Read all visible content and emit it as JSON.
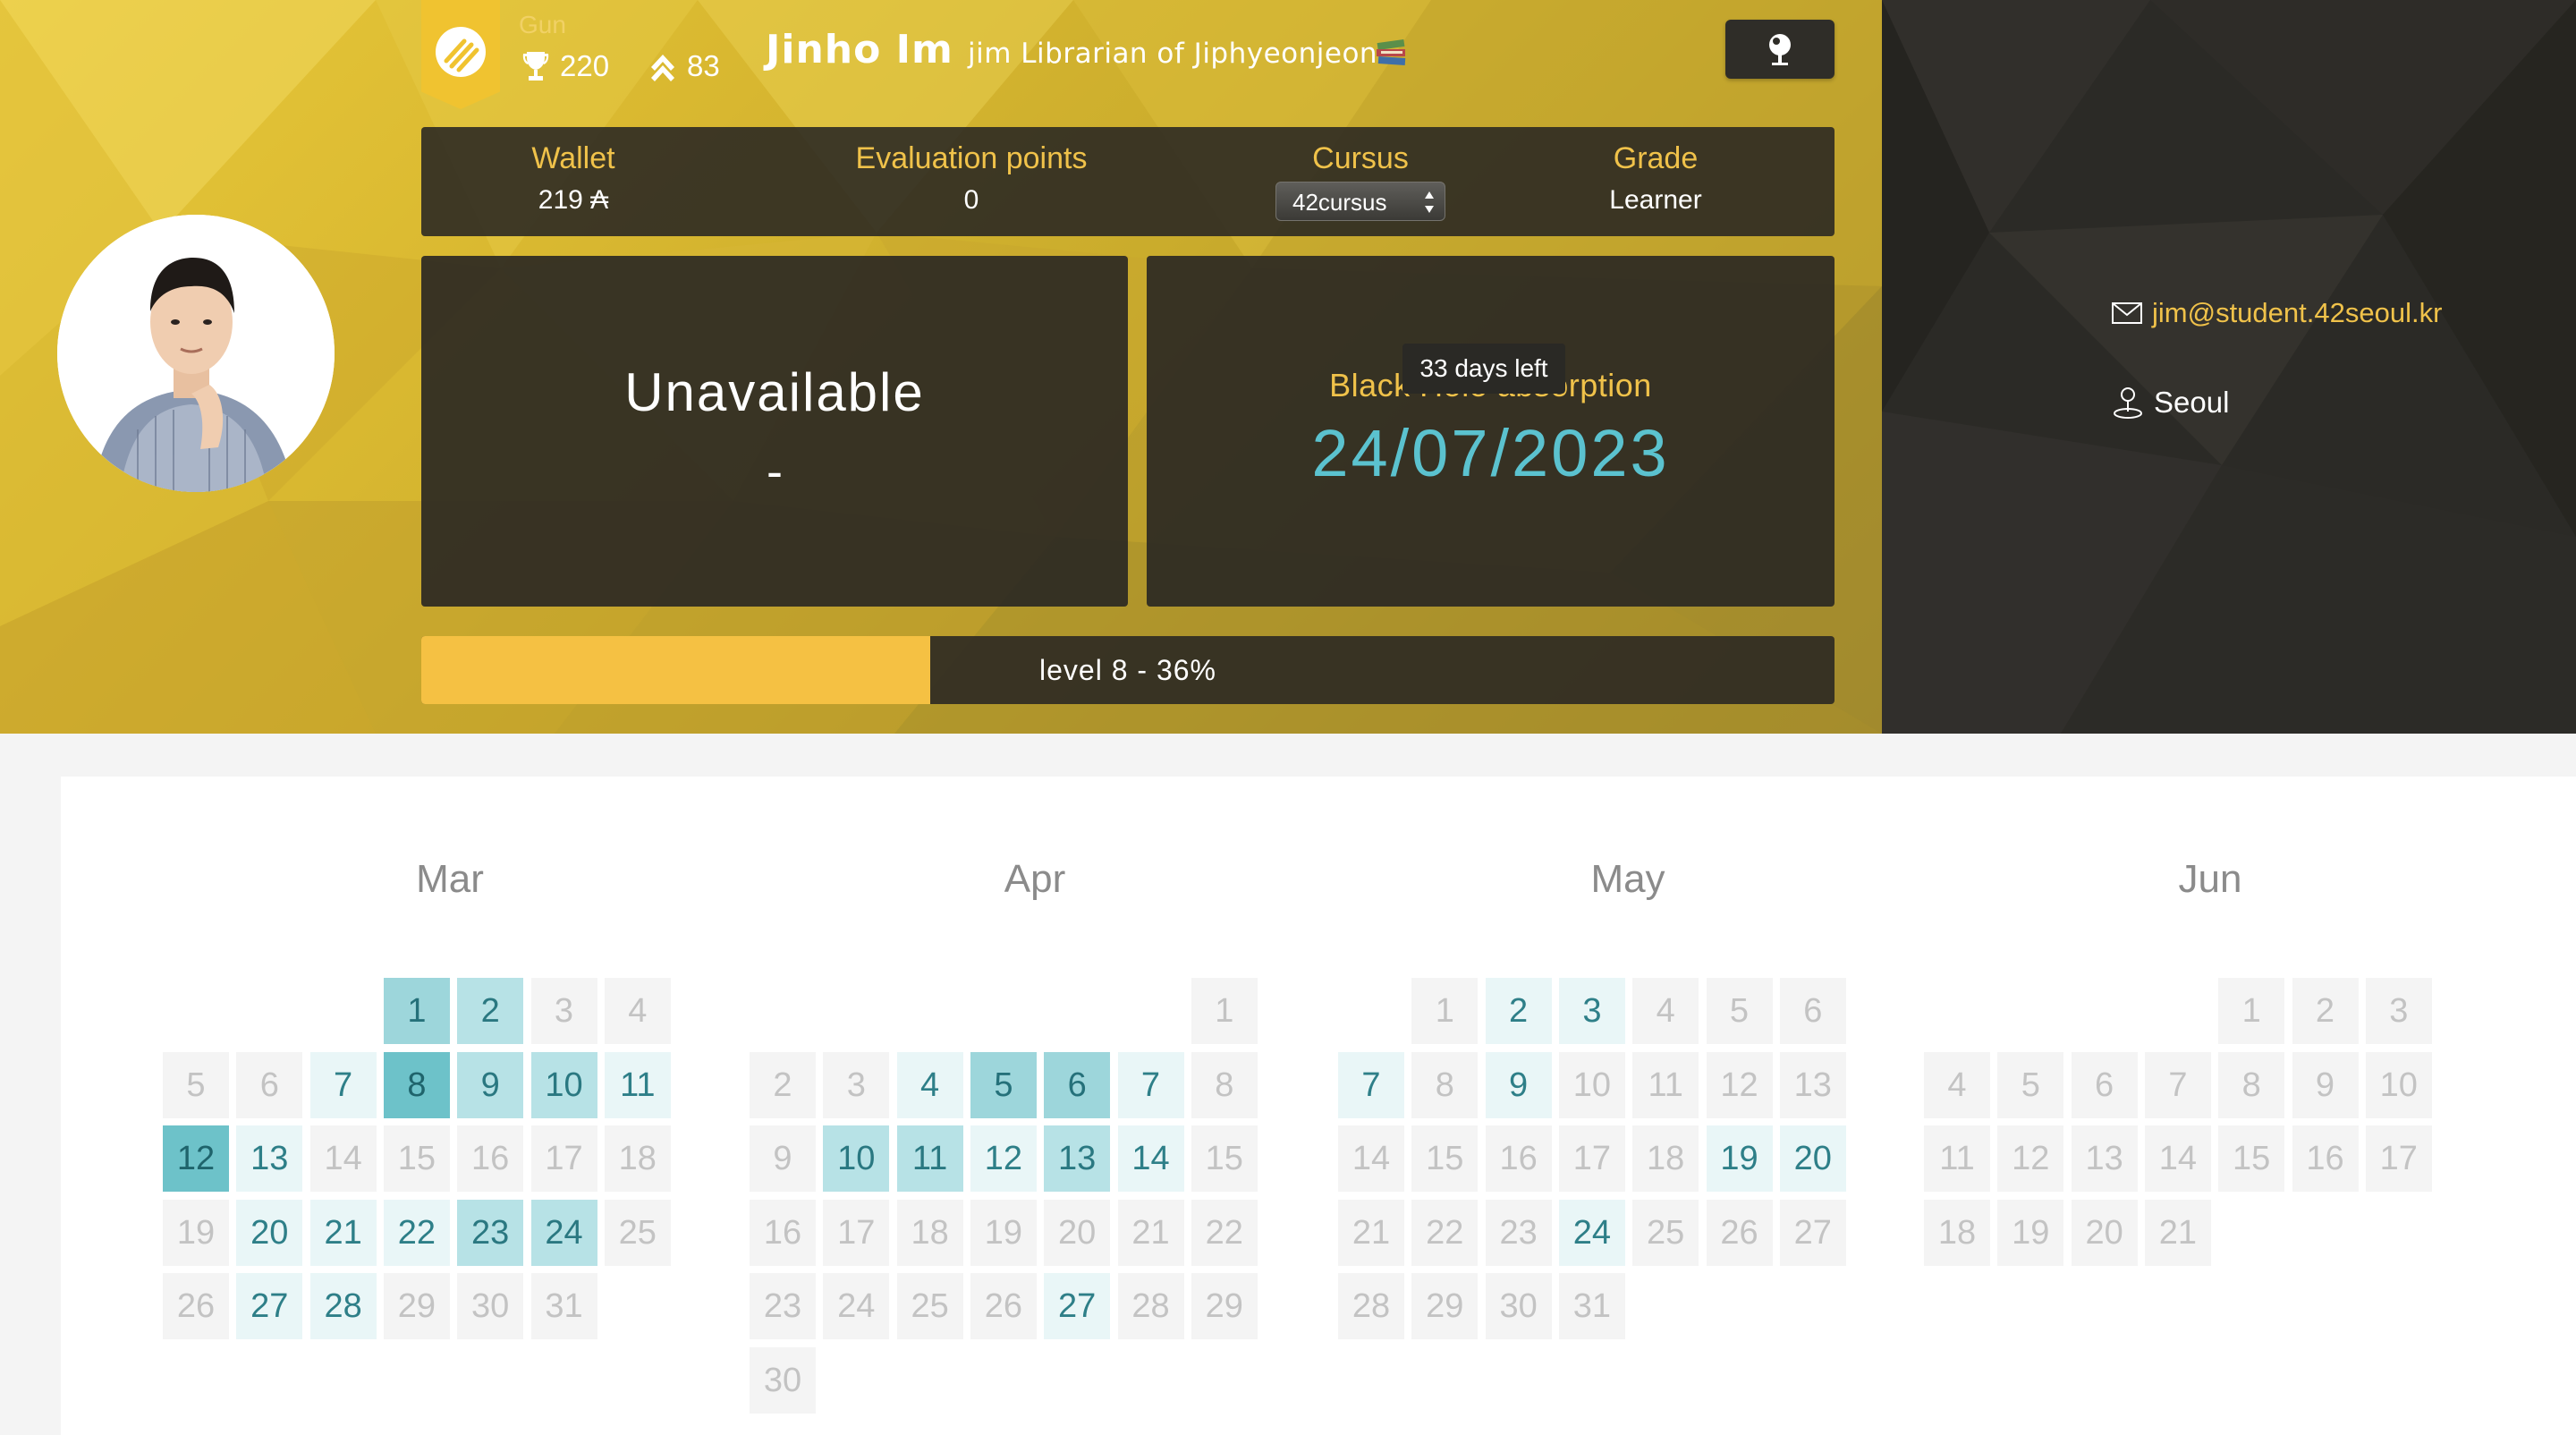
{
  "header": {
    "coalition": "Gun",
    "trophy_score": "220",
    "rank_score": "83",
    "user_name": "Jinho Im",
    "user_title": "jim Librarian of Jiphyeonjeon",
    "title_icon": "book-stack-icon",
    "locate_icon": "location-pin-icon"
  },
  "info": {
    "wallet_label": "Wallet",
    "wallet_value": "219 ₳",
    "eval_label": "Evaluation points",
    "eval_value": "0",
    "cursus_label": "Cursus",
    "cursus_value": "42cursus",
    "grade_label": "Grade",
    "grade_value": "Learner"
  },
  "availability": {
    "title": "Unavailable",
    "subtitle": "-"
  },
  "blackhole": {
    "label": "Black Hole absorption",
    "tooltip": "33 days left",
    "date": "24/07/2023"
  },
  "level": {
    "text": "level 8 - 36%",
    "progress": 0.36
  },
  "contact": {
    "email": "jim@student.42seoul.kr",
    "city": "Seoul"
  },
  "colors": {
    "accent": "#f5c143",
    "teal_text": "#5bc2cf",
    "panel": "#2b2a26",
    "heat": [
      "#f4f4f4",
      "#e9f6f7",
      "#b7e2e6",
      "#9dd6db",
      "#6dc2c9"
    ]
  },
  "calendar": [
    {
      "month": "Mar",
      "days": [
        {
          "d": "1",
          "w": 3,
          "r": 0,
          "l": 3
        },
        {
          "d": "2",
          "w": 4,
          "r": 0,
          "l": 2
        },
        {
          "d": "3",
          "w": 5,
          "r": 0,
          "l": 0
        },
        {
          "d": "4",
          "w": 6,
          "r": 0,
          "l": 0
        },
        {
          "d": "5",
          "w": 0,
          "r": 1,
          "l": 0
        },
        {
          "d": "6",
          "w": 1,
          "r": 1,
          "l": 0
        },
        {
          "d": "7",
          "w": 2,
          "r": 1,
          "l": 1
        },
        {
          "d": "8",
          "w": 3,
          "r": 1,
          "l": 4
        },
        {
          "d": "9",
          "w": 4,
          "r": 1,
          "l": 2
        },
        {
          "d": "10",
          "w": 5,
          "r": 1,
          "l": 2
        },
        {
          "d": "11",
          "w": 6,
          "r": 1,
          "l": 1
        },
        {
          "d": "12",
          "w": 0,
          "r": 2,
          "l": 4
        },
        {
          "d": "13",
          "w": 1,
          "r": 2,
          "l": 1
        },
        {
          "d": "14",
          "w": 2,
          "r": 2,
          "l": 0
        },
        {
          "d": "15",
          "w": 3,
          "r": 2,
          "l": 0
        },
        {
          "d": "16",
          "w": 4,
          "r": 2,
          "l": 0
        },
        {
          "d": "17",
          "w": 5,
          "r": 2,
          "l": 0
        },
        {
          "d": "18",
          "w": 6,
          "r": 2,
          "l": 0
        },
        {
          "d": "19",
          "w": 0,
          "r": 3,
          "l": 0
        },
        {
          "d": "20",
          "w": 1,
          "r": 3,
          "l": 1
        },
        {
          "d": "21",
          "w": 2,
          "r": 3,
          "l": 1
        },
        {
          "d": "22",
          "w": 3,
          "r": 3,
          "l": 1
        },
        {
          "d": "23",
          "w": 4,
          "r": 3,
          "l": 2
        },
        {
          "d": "24",
          "w": 5,
          "r": 3,
          "l": 2
        },
        {
          "d": "25",
          "w": 6,
          "r": 3,
          "l": 0
        },
        {
          "d": "26",
          "w": 0,
          "r": 4,
          "l": 0
        },
        {
          "d": "27",
          "w": 1,
          "r": 4,
          "l": 1
        },
        {
          "d": "28",
          "w": 2,
          "r": 4,
          "l": 1
        },
        {
          "d": "29",
          "w": 3,
          "r": 4,
          "l": 0
        },
        {
          "d": "30",
          "w": 4,
          "r": 4,
          "l": 0
        },
        {
          "d": "31",
          "w": 5,
          "r": 4,
          "l": 0
        }
      ]
    },
    {
      "month": "Apr",
      "days": [
        {
          "d": "1",
          "w": 6,
          "r": 0,
          "l": 0
        },
        {
          "d": "2",
          "w": 0,
          "r": 1,
          "l": 0
        },
        {
          "d": "3",
          "w": 1,
          "r": 1,
          "l": 0
        },
        {
          "d": "4",
          "w": 2,
          "r": 1,
          "l": 1
        },
        {
          "d": "5",
          "w": 3,
          "r": 1,
          "l": 3
        },
        {
          "d": "6",
          "w": 4,
          "r": 1,
          "l": 3
        },
        {
          "d": "7",
          "w": 5,
          "r": 1,
          "l": 1
        },
        {
          "d": "8",
          "w": 6,
          "r": 1,
          "l": 0
        },
        {
          "d": "9",
          "w": 0,
          "r": 2,
          "l": 0
        },
        {
          "d": "10",
          "w": 1,
          "r": 2,
          "l": 2
        },
        {
          "d": "11",
          "w": 2,
          "r": 2,
          "l": 2
        },
        {
          "d": "12",
          "w": 3,
          "r": 2,
          "l": 1
        },
        {
          "d": "13",
          "w": 4,
          "r": 2,
          "l": 2
        },
        {
          "d": "14",
          "w": 5,
          "r": 2,
          "l": 1
        },
        {
          "d": "15",
          "w": 6,
          "r": 2,
          "l": 0
        },
        {
          "d": "16",
          "w": 0,
          "r": 3,
          "l": 0
        },
        {
          "d": "17",
          "w": 1,
          "r": 3,
          "l": 0
        },
        {
          "d": "18",
          "w": 2,
          "r": 3,
          "l": 0
        },
        {
          "d": "19",
          "w": 3,
          "r": 3,
          "l": 0
        },
        {
          "d": "20",
          "w": 4,
          "r": 3,
          "l": 0
        },
        {
          "d": "21",
          "w": 5,
          "r": 3,
          "l": 0
        },
        {
          "d": "22",
          "w": 6,
          "r": 3,
          "l": 0
        },
        {
          "d": "23",
          "w": 0,
          "r": 4,
          "l": 0
        },
        {
          "d": "24",
          "w": 1,
          "r": 4,
          "l": 0
        },
        {
          "d": "25",
          "w": 2,
          "r": 4,
          "l": 0
        },
        {
          "d": "26",
          "w": 3,
          "r": 4,
          "l": 0
        },
        {
          "d": "27",
          "w": 4,
          "r": 4,
          "l": 1
        },
        {
          "d": "28",
          "w": 5,
          "r": 4,
          "l": 0
        },
        {
          "d": "29",
          "w": 6,
          "r": 4,
          "l": 0
        },
        {
          "d": "30",
          "w": 0,
          "r": 5,
          "l": 0
        }
      ]
    },
    {
      "month": "May",
      "days": [
        {
          "d": "1",
          "w": 1,
          "r": 0,
          "l": 0
        },
        {
          "d": "2",
          "w": 2,
          "r": 0,
          "l": 1
        },
        {
          "d": "3",
          "w": 3,
          "r": 0,
          "l": 1
        },
        {
          "d": "4",
          "w": 4,
          "r": 0,
          "l": 0
        },
        {
          "d": "5",
          "w": 5,
          "r": 0,
          "l": 0
        },
        {
          "d": "6",
          "w": 6,
          "r": 0,
          "l": 0
        },
        {
          "d": "7",
          "w": 0,
          "r": 1,
          "l": 1
        },
        {
          "d": "8",
          "w": 1,
          "r": 1,
          "l": 0
        },
        {
          "d": "9",
          "w": 2,
          "r": 1,
          "l": 1
        },
        {
          "d": "10",
          "w": 3,
          "r": 1,
          "l": 0
        },
        {
          "d": "11",
          "w": 4,
          "r": 1,
          "l": 0
        },
        {
          "d": "12",
          "w": 5,
          "r": 1,
          "l": 0
        },
        {
          "d": "13",
          "w": 6,
          "r": 1,
          "l": 0
        },
        {
          "d": "14",
          "w": 0,
          "r": 2,
          "l": 0
        },
        {
          "d": "15",
          "w": 1,
          "r": 2,
          "l": 0
        },
        {
          "d": "16",
          "w": 2,
          "r": 2,
          "l": 0
        },
        {
          "d": "17",
          "w": 3,
          "r": 2,
          "l": 0
        },
        {
          "d": "18",
          "w": 4,
          "r": 2,
          "l": 0
        },
        {
          "d": "19",
          "w": 5,
          "r": 2,
          "l": 1
        },
        {
          "d": "20",
          "w": 6,
          "r": 2,
          "l": 1
        },
        {
          "d": "21",
          "w": 0,
          "r": 3,
          "l": 0
        },
        {
          "d": "22",
          "w": 1,
          "r": 3,
          "l": 0
        },
        {
          "d": "23",
          "w": 2,
          "r": 3,
          "l": 0
        },
        {
          "d": "24",
          "w": 3,
          "r": 3,
          "l": 1
        },
        {
          "d": "25",
          "w": 4,
          "r": 3,
          "l": 0
        },
        {
          "d": "26",
          "w": 5,
          "r": 3,
          "l": 0
        },
        {
          "d": "27",
          "w": 6,
          "r": 3,
          "l": 0
        },
        {
          "d": "28",
          "w": 0,
          "r": 4,
          "l": 0
        },
        {
          "d": "29",
          "w": 1,
          "r": 4,
          "l": 0
        },
        {
          "d": "30",
          "w": 2,
          "r": 4,
          "l": 0
        },
        {
          "d": "31",
          "w": 3,
          "r": 4,
          "l": 0
        }
      ]
    },
    {
      "month": "Jun",
      "days": [
        {
          "d": "1",
          "w": 4,
          "r": 0,
          "l": 0
        },
        {
          "d": "2",
          "w": 5,
          "r": 0,
          "l": 0
        },
        {
          "d": "3",
          "w": 6,
          "r": 0,
          "l": 0
        },
        {
          "d": "4",
          "w": 0,
          "r": 1,
          "l": 0
        },
        {
          "d": "5",
          "w": 1,
          "r": 1,
          "l": 0
        },
        {
          "d": "6",
          "w": 2,
          "r": 1,
          "l": 0
        },
        {
          "d": "7",
          "w": 3,
          "r": 1,
          "l": 0
        },
        {
          "d": "8",
          "w": 4,
          "r": 1,
          "l": 0
        },
        {
          "d": "9",
          "w": 5,
          "r": 1,
          "l": 0
        },
        {
          "d": "10",
          "w": 6,
          "r": 1,
          "l": 0
        },
        {
          "d": "11",
          "w": 0,
          "r": 2,
          "l": 0
        },
        {
          "d": "12",
          "w": 1,
          "r": 2,
          "l": 0
        },
        {
          "d": "13",
          "w": 2,
          "r": 2,
          "l": 0
        },
        {
          "d": "14",
          "w": 3,
          "r": 2,
          "l": 0
        },
        {
          "d": "15",
          "w": 4,
          "r": 2,
          "l": 0
        },
        {
          "d": "16",
          "w": 5,
          "r": 2,
          "l": 0
        },
        {
          "d": "17",
          "w": 6,
          "r": 2,
          "l": 0
        },
        {
          "d": "18",
          "w": 0,
          "r": 3,
          "l": 0
        },
        {
          "d": "19",
          "w": 1,
          "r": 3,
          "l": 0
        },
        {
          "d": "20",
          "w": 2,
          "r": 3,
          "l": 0
        },
        {
          "d": "21",
          "w": 3,
          "r": 3,
          "l": 0
        }
      ]
    }
  ]
}
